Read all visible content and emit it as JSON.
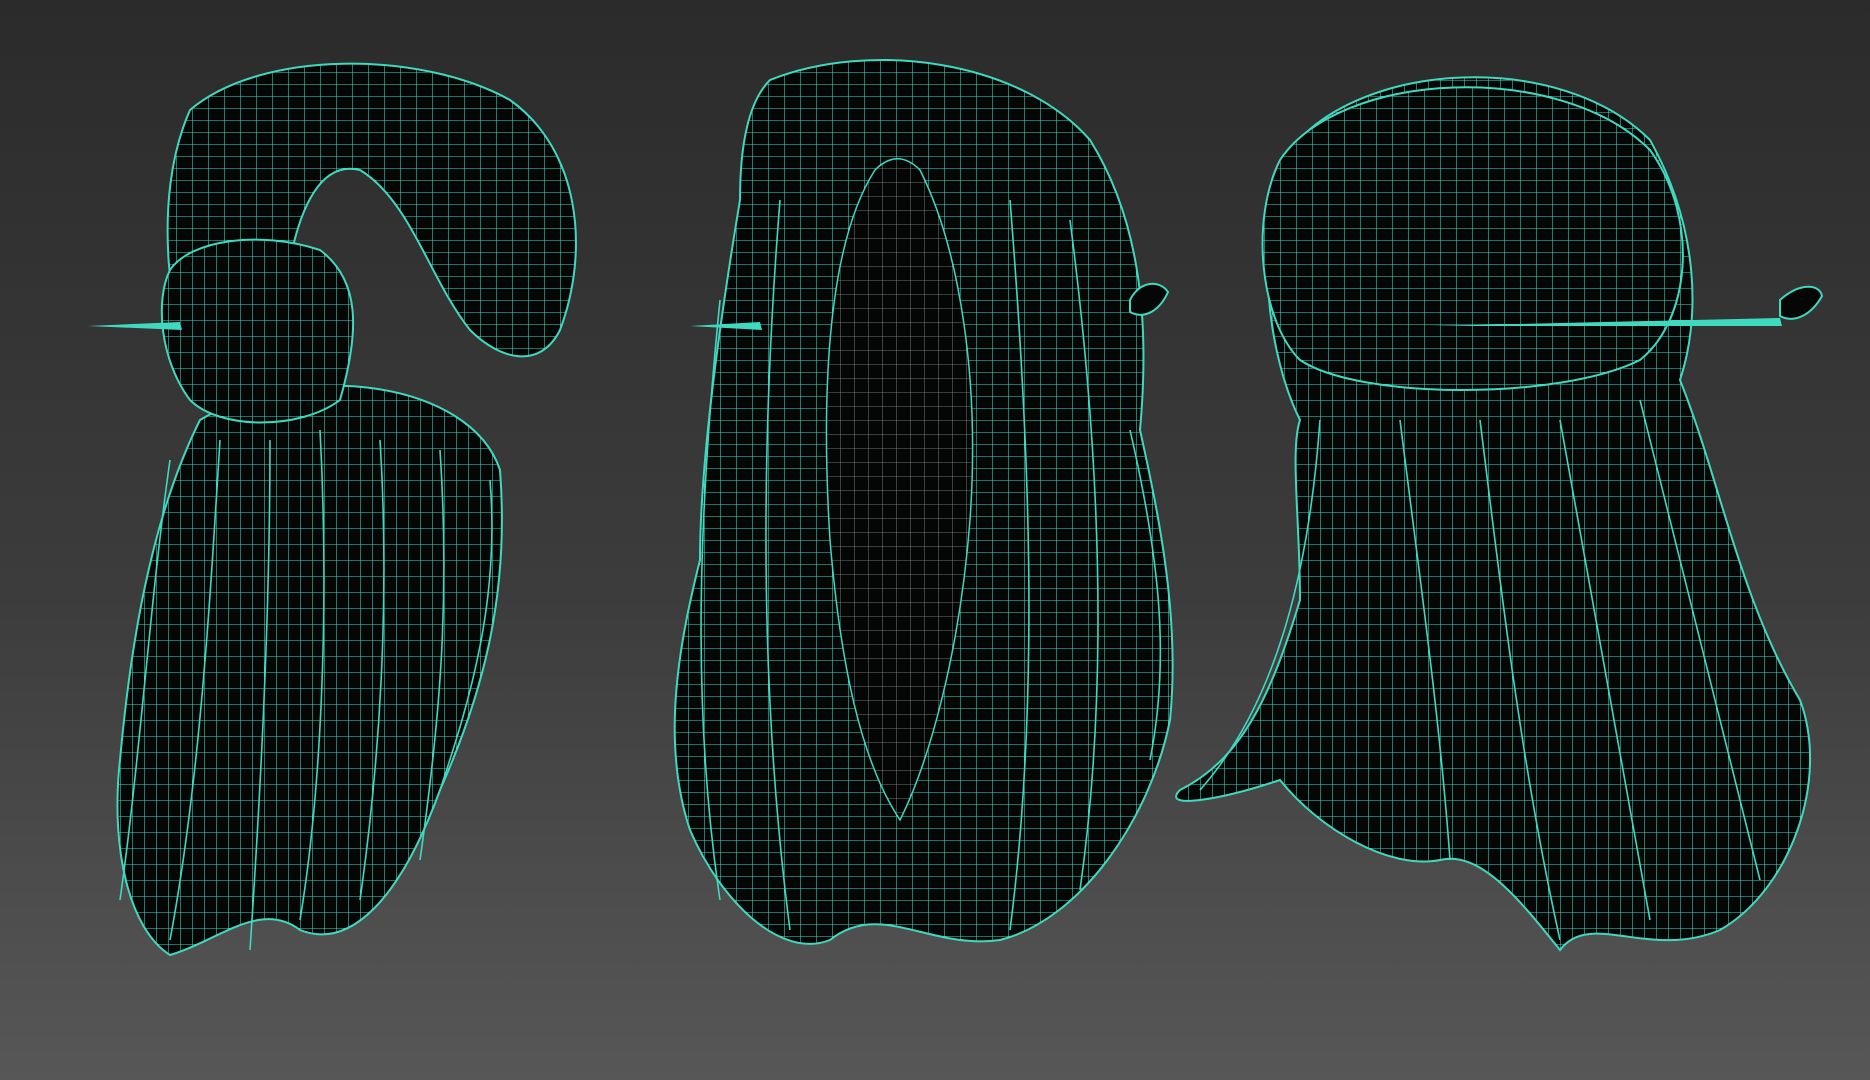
{
  "viewport": {
    "wire_color": "#3fd9c0",
    "interior_color": "#050606",
    "background_top": "#2b2b2b",
    "background_bottom": "#575757"
  },
  "models": [
    {
      "label": "",
      "view": "three-quarter-left",
      "accessory": "hairpin"
    },
    {
      "label": "",
      "view": "front",
      "accessory": "hairpin"
    },
    {
      "label": "",
      "view": "back",
      "accessory": "hairpin"
    }
  ]
}
